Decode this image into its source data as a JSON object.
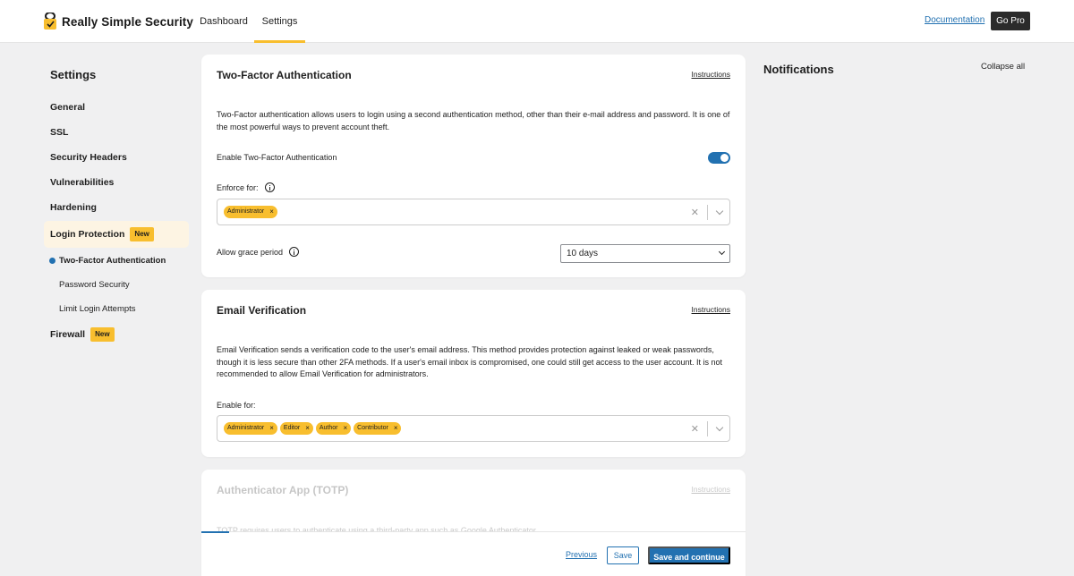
{
  "header": {
    "app_name": "Really Simple Security",
    "tabs": [
      {
        "label": "Dashboard",
        "active": false
      },
      {
        "label": "Settings",
        "active": true
      }
    ],
    "documentation_label": "Documentation",
    "go_pro_label": "Go Pro",
    "logo_icon": "shield-icon"
  },
  "sidebar": {
    "title": "Settings",
    "items": [
      {
        "label": "General"
      },
      {
        "label": "SSL"
      },
      {
        "label": "Security Headers"
      },
      {
        "label": "Vulnerabilities"
      },
      {
        "label": "Hardening"
      },
      {
        "label": "Login Protection",
        "badge": "New",
        "active": true
      },
      {
        "label": "Firewall",
        "badge": "New"
      }
    ],
    "sub_items": [
      {
        "label": "Two-Factor Authentication",
        "active": true
      },
      {
        "label": "Password Security"
      },
      {
        "label": "Limit Login Attempts"
      }
    ]
  },
  "cards": {
    "two_factor": {
      "title": "Two-Factor Authentication",
      "instructions_label": "Instructions",
      "description": "Two-Factor authentication allows users to login using a second authentication method, other than their e-mail address and password. It is one of the most powerful ways to prevent account theft.",
      "enable_label": "Enable Two-Factor Authentication",
      "enabled": true,
      "enforce_label": "Enforce for:",
      "enforce_roles": [
        "Administrator"
      ],
      "grace_label": "Allow grace period",
      "grace_value": "10 days"
    },
    "email": {
      "title": "Email Verification",
      "instructions_label": "Instructions",
      "description": "Email Verification sends a verification code to the user's email address. This method provides protection against leaked or weak passwords, though it is less secure than other 2FA methods. If a user's email inbox is compromised, one could still get access to the user account. It is not recommended to allow Email Verification for administrators.",
      "enable_label": "Enable for:",
      "roles": [
        "Administrator",
        "Editor",
        "Author",
        "Contributor"
      ]
    },
    "totp": {
      "title": "Authenticator App (TOTP)",
      "instructions_label": "Instructions",
      "description": "TOTP requires users to authenticate using a third-party app such as Google Authenticator."
    }
  },
  "footer": {
    "previous_label": "Previous",
    "save_label": "Save",
    "save_continue_label": "Save and continue"
  },
  "notifications": {
    "title": "Notifications",
    "collapse_label": "Collapse all"
  },
  "colors": {
    "accent_blue": "#2271b1",
    "accent_yellow": "#f8be2e",
    "background": "#f0f0f1"
  }
}
